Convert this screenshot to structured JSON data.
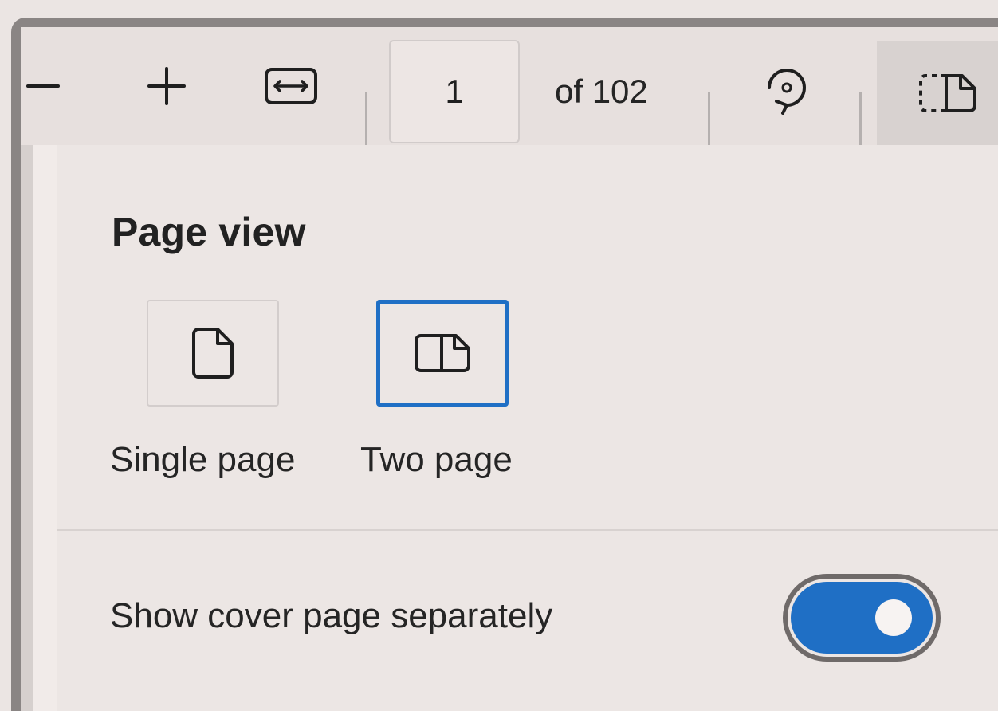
{
  "toolbar": {
    "zoom_out_icon": "minus-icon",
    "zoom_in_icon": "plus-icon",
    "fit_width_icon": "fit-width-icon",
    "page_number": "1",
    "page_total_text": "of 102",
    "rotate_icon": "rotate-icon",
    "page_view_icon": "two-page-icon"
  },
  "panel": {
    "title": "Page view",
    "options": [
      {
        "label": "Single page",
        "icon": "single-page-icon",
        "selected": false
      },
      {
        "label": "Two page",
        "icon": "two-page-icon",
        "selected": true
      }
    ],
    "cover_label": "Show cover page separately",
    "cover_toggle_on": true
  },
  "colors": {
    "accent": "#1f6fc5",
    "toggle_knob": "#f7f3f2"
  }
}
